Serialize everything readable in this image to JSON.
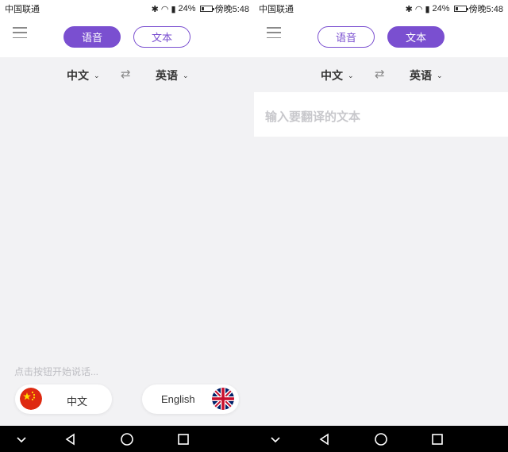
{
  "screens": [
    {
      "status": {
        "carrier": "中国联通",
        "battery": "24%",
        "time": "傍晚5:48"
      },
      "menu_icon": "menu-icon",
      "tabs": [
        {
          "label": "语音",
          "active": true
        },
        {
          "label": "文本",
          "active": false
        }
      ],
      "source_lang": "中文",
      "target_lang": "英语",
      "swap_icon": "swap-icon",
      "hint": "点击按钮开始说话...",
      "voice_buttons": [
        {
          "label": "中文",
          "flag": "china-flag-icon"
        },
        {
          "label": "English",
          "flag": "uk-flag-icon"
        }
      ]
    },
    {
      "status": {
        "carrier": "中国联通",
        "battery": "24%",
        "time": "傍晚5:48"
      },
      "menu_icon": "menu-icon",
      "tabs": [
        {
          "label": "语音",
          "active": false
        },
        {
          "label": "文本",
          "active": true
        }
      ],
      "source_lang": "中文",
      "target_lang": "英语",
      "swap_icon": "swap-icon",
      "input_placeholder": "输入要翻译的文本"
    }
  ],
  "colors": {
    "accent": "#7a4fd0",
    "background": "#f2f2f4",
    "navbar": "#000000"
  },
  "navbar_icons": [
    "chevron-down-icon",
    "back-icon",
    "home-icon",
    "recents-icon"
  ]
}
